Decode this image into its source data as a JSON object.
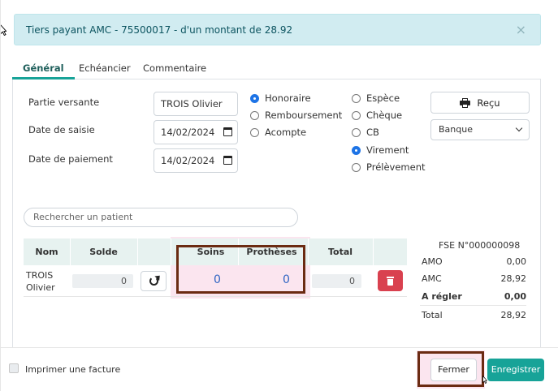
{
  "alert": {
    "text": "Tiers payant AMC - 75500017 - d'un montant de 28.92",
    "close": "×"
  },
  "tabs": [
    {
      "label": "Général",
      "active": true
    },
    {
      "label": "Echéancier",
      "active": false
    },
    {
      "label": "Commentaire",
      "active": false
    }
  ],
  "form": {
    "partie_label": "Partie versante",
    "partie_value": "TROIS Olivier",
    "saisie_label": "Date de saisie",
    "saisie_value": "14/02/2024",
    "paiement_label": "Date de paiement",
    "paiement_value": "14/02/2024"
  },
  "type_options": [
    {
      "label": "Honoraire",
      "checked": true
    },
    {
      "label": "Remboursement",
      "checked": false
    },
    {
      "label": "Acompte",
      "checked": false
    }
  ],
  "payment_options": [
    {
      "label": "Espèce",
      "checked": false
    },
    {
      "label": "Chèque",
      "checked": false
    },
    {
      "label": "CB",
      "checked": false
    },
    {
      "label": "Virement",
      "checked": true
    },
    {
      "label": "Prélèvement",
      "checked": false
    }
  ],
  "recu_button": "Reçu",
  "bank_select": "Banque",
  "search_placeholder": "Rechercher un patient",
  "table": {
    "headers": [
      "Nom",
      "Solde",
      "",
      "Soins",
      "Prothèses",
      "Total",
      ""
    ],
    "row": {
      "nom_line1": "TROIS",
      "nom_line2": "Olivier",
      "solde": "0",
      "soins": "0",
      "protheses": "0",
      "total": "0"
    }
  },
  "fse": {
    "title": "FSE N°000000098",
    "rows": [
      {
        "label": "AMO",
        "value": "0,00",
        "bold": false
      },
      {
        "label": "AMC",
        "value": "28,92",
        "bold": false
      },
      {
        "label": "A régler",
        "value": "0,00",
        "bold": true
      },
      {
        "label": "Total",
        "value": "28,92",
        "bold": false
      }
    ]
  },
  "footer": {
    "print_label": "Imprimer une facture",
    "close_button": "Fermer",
    "save_button": "Enregistrer"
  },
  "colors": {
    "primary": "#17a398",
    "danger": "#d9414f",
    "alert_bg": "#d1ecf1",
    "highlight_box": "#6b2b12"
  }
}
